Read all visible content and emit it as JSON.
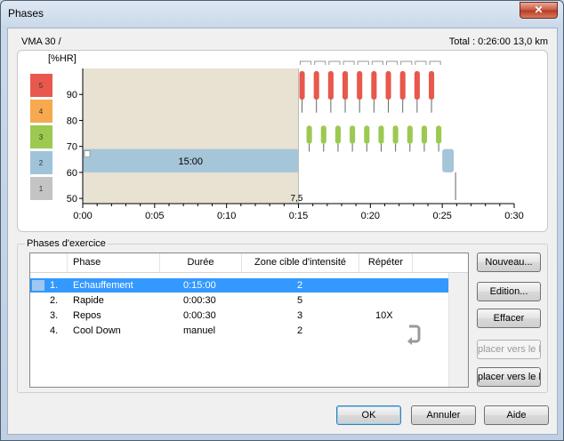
{
  "window": {
    "title": "Phases",
    "close": "✕"
  },
  "header": {
    "left": "VMA 30  /",
    "right": "Total : 0:26:00   13,0 km"
  },
  "chart_data": {
    "type": "area",
    "ylabel": "[%HR]",
    "y_ticks": [
      "90",
      "80",
      "70",
      "60",
      "50"
    ],
    "x_ticks": [
      "0:00",
      "0:05",
      "0:10",
      "0:15",
      "0:20",
      "0:25",
      "0:30"
    ],
    "zones": [
      {
        "label": "5",
        "color": "#e8584c"
      },
      {
        "label": "4",
        "color": "#f6a94e"
      },
      {
        "label": "3",
        "color": "#9cc950"
      },
      {
        "label": "2",
        "color": "#9fc3d9"
      },
      {
        "label": "1",
        "color": "#c4c4c4"
      }
    ],
    "warmup": {
      "label": "15:00",
      "start_min": 0,
      "end_min": 15,
      "hr_low": 60,
      "hr_high": 69
    },
    "cooldown": {
      "start_min": 25,
      "end_min": 25.8,
      "hr_low": 60,
      "hr_high": 69
    },
    "intervals": {
      "repeats": 10,
      "hard_sec": 30,
      "easy_sec": 30,
      "start_min": 15
    },
    "marker_label": "7,5",
    "x_range": [
      0,
      30
    ],
    "y_range": [
      48,
      100
    ]
  },
  "phases_group": {
    "label": "Phases d'exercice"
  },
  "table": {
    "columns": [
      "Phase",
      "Durée",
      "Zone cible d'intensité",
      "Répéter"
    ],
    "rows": [
      {
        "num": "1.",
        "phase": "Echauffement",
        "duree": "0:15:00",
        "zone": "2",
        "repeter": ""
      },
      {
        "num": "2.",
        "phase": "Rapide",
        "duree": "0:00:30",
        "zone": "5",
        "repeter": ""
      },
      {
        "num": "3.",
        "phase": "Repos",
        "duree": "0:00:30",
        "zone": "3",
        "repeter": "10X"
      },
      {
        "num": "4.",
        "phase": "Cool Down",
        "duree": "manuel",
        "zone": "2",
        "repeter": ""
      }
    ]
  },
  "buttons": {
    "new": "Nouveau...",
    "edit": "Edition...",
    "delete": "Effacer",
    "move_up": "placer vers le h",
    "move_down": "placer vers le b",
    "ok": "OK",
    "cancel": "Annuler",
    "help": "Aide"
  },
  "icons": {
    "repeat": "repeat-arrow-icon",
    "info": "info-icon"
  }
}
